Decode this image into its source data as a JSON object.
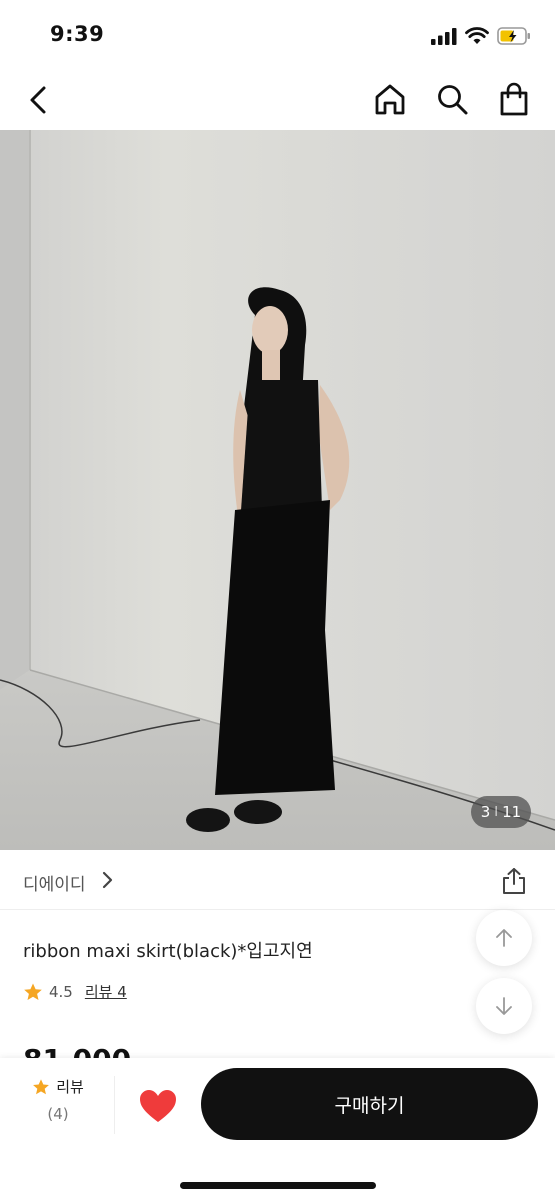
{
  "status": {
    "time": "9:39"
  },
  "nav": {
    "back_icon": "chevron-left-icon",
    "home_icon": "home-icon",
    "search_icon": "search-icon",
    "cart_icon": "shopping-bag-icon"
  },
  "image": {
    "current": "3",
    "total": "11",
    "separator": "I"
  },
  "brand": {
    "name": "디에이디"
  },
  "product": {
    "title": "ribbon maxi skirt(black)*입고지연",
    "rating": "4.5",
    "review_label": "리뷰 4",
    "price_partial": "81,000"
  },
  "bottom": {
    "review_label": "리뷰",
    "review_count": "(4)",
    "buy_label": "구매하기"
  },
  "colors": {
    "accent_star": "#f5a623",
    "heart": "#ef3b3b",
    "buy_bg": "#111111"
  }
}
